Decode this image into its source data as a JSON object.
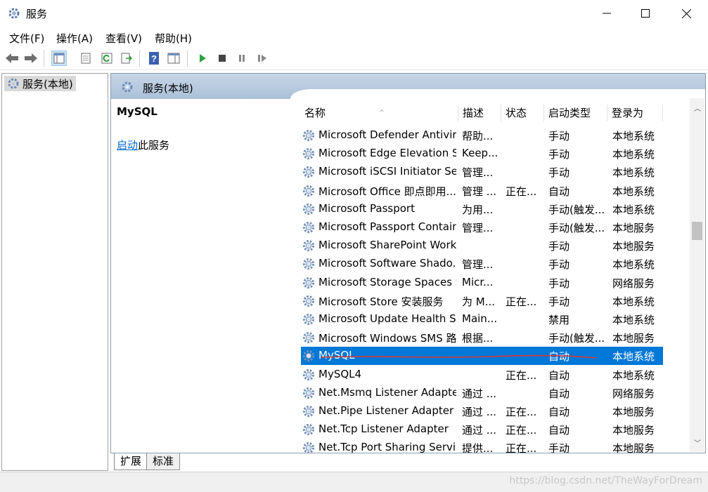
{
  "window": {
    "title": "服务"
  },
  "menu": [
    "文件(F)",
    "操作(A)",
    "查看(V)",
    "帮助(H)"
  ],
  "tree": {
    "root": "服务(本地)"
  },
  "pane": {
    "header": "服务(本地)",
    "selected_service": "MySQL",
    "start_link": "启动",
    "start_suffix": "此服务"
  },
  "columns": [
    "名称",
    "描述",
    "状态",
    "启动类型",
    "登录为"
  ],
  "rows": [
    {
      "name": "Microsoft Defender Antivir...",
      "desc": "帮助...",
      "status": "",
      "type": "手动",
      "logon": "本地系统"
    },
    {
      "name": "Microsoft Edge Elevation S...",
      "desc": "Keep...",
      "status": "",
      "type": "手动",
      "logon": "本地系统"
    },
    {
      "name": "Microsoft iSCSI Initiator Ser...",
      "desc": "管理...",
      "status": "",
      "type": "手动",
      "logon": "本地系统"
    },
    {
      "name": "Microsoft Office 即点即用...",
      "desc": "管理 ...",
      "status": "正在...",
      "type": "自动",
      "logon": "本地系统"
    },
    {
      "name": "Microsoft Passport",
      "desc": "为用...",
      "status": "",
      "type": "手动(触发...",
      "logon": "本地系统"
    },
    {
      "name": "Microsoft Passport Container",
      "desc": "管理...",
      "status": "",
      "type": "手动(触发...",
      "logon": "本地服务"
    },
    {
      "name": "Microsoft SharePoint Work...",
      "desc": "",
      "status": "",
      "type": "手动",
      "logon": "本地服务"
    },
    {
      "name": "Microsoft Software Shado...",
      "desc": "管理...",
      "status": "",
      "type": "手动",
      "logon": "本地系统"
    },
    {
      "name": "Microsoft Storage Spaces S...",
      "desc": "Micr...",
      "status": "",
      "type": "手动",
      "logon": "网络服务"
    },
    {
      "name": "Microsoft Store 安装服务",
      "desc": "为 M...",
      "status": "正在...",
      "type": "手动",
      "logon": "本地系统"
    },
    {
      "name": "Microsoft Update Health S...",
      "desc": "Main...",
      "status": "",
      "type": "禁用",
      "logon": "本地系统"
    },
    {
      "name": "Microsoft Windows SMS 路...",
      "desc": "根据...",
      "status": "",
      "type": "手动(触发...",
      "logon": "本地服务"
    },
    {
      "name": "MySQL",
      "desc": "",
      "status": "",
      "type": "自动",
      "logon": "本地系统",
      "selected": true
    },
    {
      "name": "MySQL4",
      "desc": "",
      "status": "正在...",
      "type": "自动",
      "logon": "本地系统"
    },
    {
      "name": "Net.Msmq Listener Adapter",
      "desc": "通过 ...",
      "status": "",
      "type": "自动",
      "logon": "网络服务"
    },
    {
      "name": "Net.Pipe Listener Adapter",
      "desc": "通过 ...",
      "status": "正在...",
      "type": "自动",
      "logon": "本地服务"
    },
    {
      "name": "Net.Tcp Listener Adapter",
      "desc": "通过 ...",
      "status": "正在...",
      "type": "自动",
      "logon": "本地服务"
    },
    {
      "name": "Net.Tcp Port Sharing Service",
      "desc": "提供...",
      "status": "正在...",
      "type": "手动",
      "logon": "本地服务"
    }
  ],
  "tabs": [
    "扩展",
    "标准"
  ],
  "watermark": "https://blog.csdn.net/TheWayForDream",
  "colors": {
    "selection": "#0078d7",
    "header": "#aac0d8",
    "link": "#0066cc"
  }
}
